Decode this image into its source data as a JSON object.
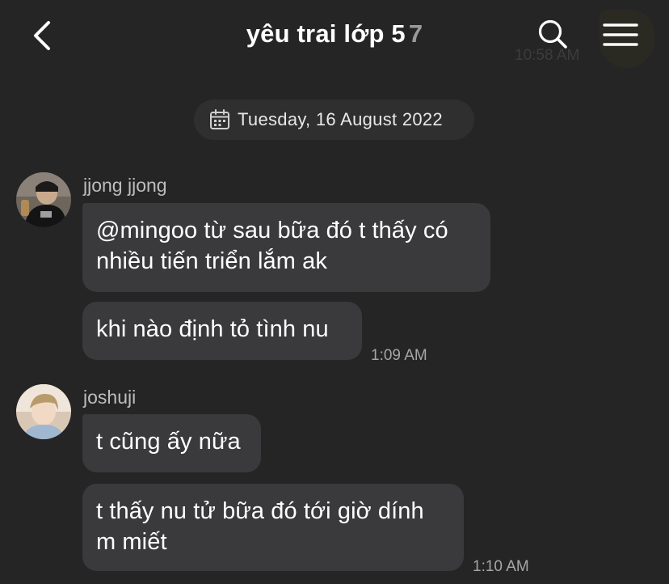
{
  "header": {
    "title": "yêu trai lớp 5",
    "member_count": "7",
    "faded_time": "10:58 AM",
    "back_icon": "chevron-left-icon",
    "search_icon": "search-icon",
    "menu_icon": "hamburger-menu-icon"
  },
  "date_separator": {
    "icon": "calendar-icon",
    "label": "Tuesday, 16 August 2022"
  },
  "groups": [
    {
      "sender": "jjong jjong",
      "messages": [
        {
          "text": "@mingoo từ sau bữa đó t thấy có nhiều tiến triển lắm ak"
        },
        {
          "text": "khi nào định tỏ tình nu",
          "time": "1:09 AM"
        }
      ]
    },
    {
      "sender": "joshuji",
      "messages": [
        {
          "text": "t cũng ấy nữa"
        },
        {
          "text": "t thấy nu tử bữa đó tới giờ dính m miết",
          "time": "1:10 AM"
        }
      ]
    }
  ],
  "colors": {
    "background": "#252526",
    "bubble": "#3a3a3c",
    "date_pill": "#2f2f30",
    "secondary_text": "#a6a6a6"
  }
}
